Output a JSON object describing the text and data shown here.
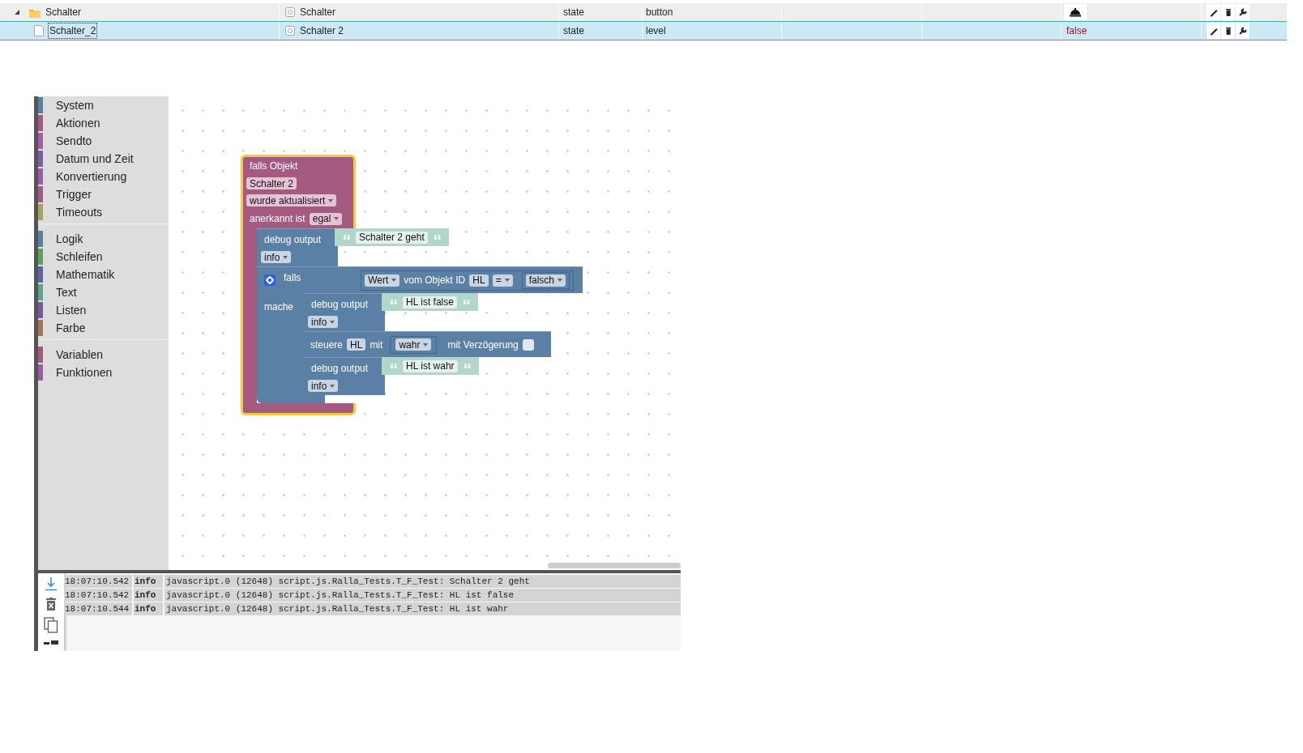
{
  "object_list": {
    "rows": [
      {
        "kind": "folder",
        "expanded": true,
        "selected": false,
        "name": "Schalter",
        "title": "Schalter",
        "type": "state",
        "role": "button"
      },
      {
        "kind": "state",
        "selected": true,
        "name": "Schalter_2",
        "title": "Schalter 2",
        "type": "state",
        "role": "level",
        "value": "false"
      }
    ]
  },
  "toolbox": {
    "groups": [
      {
        "items": [
          {
            "label": "System",
            "color": "#5b80a5"
          },
          {
            "label": "Aktionen",
            "color": "#a55b80"
          },
          {
            "label": "Sendto",
            "color": "#a55ba5"
          },
          {
            "label": "Datum und Zeit",
            "color": "#805ba5"
          },
          {
            "label": "Konvertierung",
            "color": "#9a5ba5"
          },
          {
            "label": "Trigger",
            "color": "#a55b80"
          },
          {
            "label": "Timeouts",
            "color": "#a5a55b"
          }
        ]
      },
      {
        "items": [
          {
            "label": "Logik",
            "color": "#5b80a5"
          },
          {
            "label": "Schleifen",
            "color": "#5ba55b"
          },
          {
            "label": "Mathematik",
            "color": "#5b67a5"
          },
          {
            "label": "Text",
            "color": "#5ba58c"
          },
          {
            "label": "Listen",
            "color": "#745ba5"
          },
          {
            "label": "Farbe",
            "color": "#a5745b"
          }
        ]
      },
      {
        "items": [
          {
            "label": "Variablen",
            "color": "#a55b80"
          },
          {
            "label": "Funktionen",
            "color": "#995ba5"
          }
        ]
      }
    ]
  },
  "workspace": {
    "blocks": [
      {
        "kind": "trigger",
        "selected": true,
        "title": "falls Objekt",
        "object": "Schalter 2",
        "event": "wurde aktualisiert",
        "ack_label": "anerkannt ist",
        "ack": "egal",
        "statements": [
          {
            "kind": "debug",
            "label": "debug output",
            "text": "Schalter 2 geht",
            "severity": "info"
          },
          {
            "kind": "if",
            "label": "falls",
            "do_label": "mache",
            "condition": {
              "field": "Wert",
              "label": "vom Objekt ID",
              "object": "HL",
              "operator": "=",
              "value": "falsch"
            },
            "statements": [
              {
                "kind": "debug",
                "label": "debug output",
                "text": "HL ist false",
                "severity": "info"
              },
              {
                "kind": "control",
                "label": "steuere",
                "object": "HL",
                "with_label": "mit",
                "value": "wahr",
                "delay_label": "mit Verzögerung",
                "delay": false
              },
              {
                "kind": "debug",
                "label": "debug output",
                "text": "HL ist wahr",
                "severity": "info"
              }
            ]
          }
        ]
      }
    ]
  },
  "log": {
    "lines": [
      {
        "time": "18:07:10.542",
        "severity": "info",
        "message": "javascript.0 (12648) script.js.Ralla_Tests.T_F_Test: Schalter 2 geht"
      },
      {
        "time": "18:07:10.542",
        "severity": "info",
        "message": "javascript.0 (12648) script.js.Ralla_Tests.T_F_Test: HL ist false"
      },
      {
        "time": "18:07:10.544",
        "severity": "info",
        "message": "javascript.0 (12648) script.js.Ralla_Tests.T_F_Test: HL ist wahr"
      }
    ]
  }
}
